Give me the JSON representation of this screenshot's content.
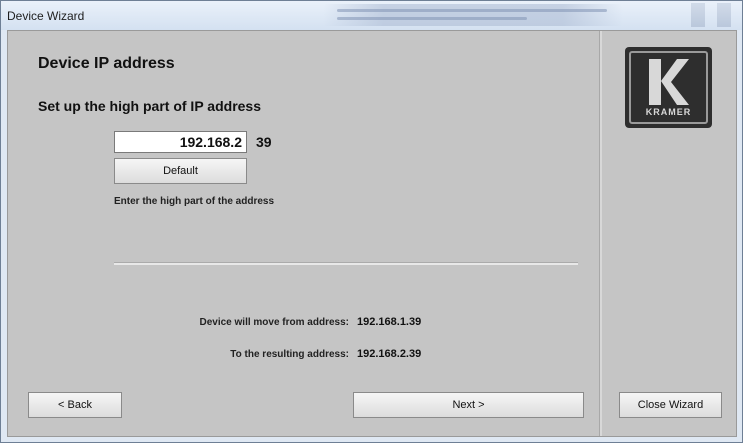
{
  "window": {
    "title": "Device Wizard"
  },
  "page": {
    "heading": "Device IP address",
    "subheading": "Set up the high part of IP address",
    "ip_high_value": "192.168.2",
    "ip_low_part": "39",
    "default_button": "Default",
    "hint": "Enter the high part of the address",
    "move_from_label": "Device will move from address:",
    "move_from_value": "192.168.1.39",
    "resulting_label": "To the resulting address:",
    "resulting_value": "192.168.2.39"
  },
  "logo": {
    "text": "KRAMER",
    "icon": "kramer-k-logo-icon"
  },
  "buttons": {
    "back": "< Back",
    "next": "Next >",
    "close": "Close Wizard"
  },
  "colors": {
    "panel": "#c5c5c5",
    "logo_bg": "#2e2e2e"
  }
}
